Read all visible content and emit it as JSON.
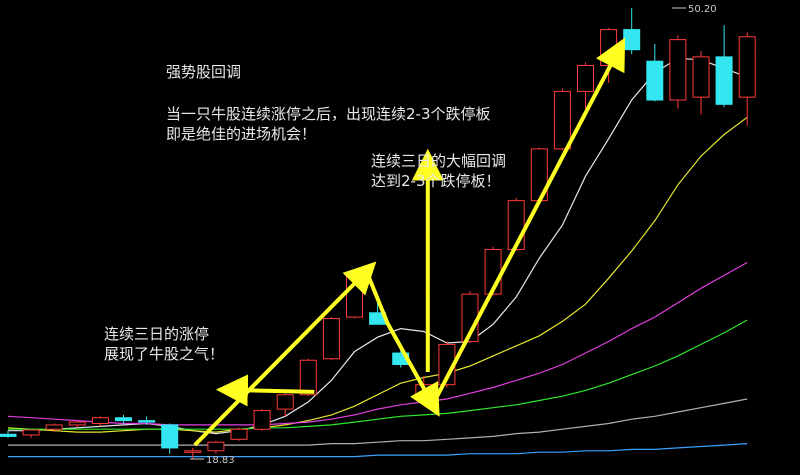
{
  "annotations": {
    "title": "强势股回调",
    "main_line1": "当一只牛股连续涨停之后，出现连续2-3个跌停板",
    "main_line2": "即是绝佳的进场机会！",
    "pullback_line1": "连续三日的大幅回调",
    "pullback_line2": "达到2-3个跌停板！",
    "limitup_line1": "连续三日的涨停",
    "limitup_line2": "展现了牛股之气！"
  },
  "chart_data": {
    "type": "candlestick",
    "price_high_label": "50.20",
    "price_low_label": "18.83",
    "colors": {
      "up": "#ff3b3b",
      "down": "#33e6f0",
      "ma5": "#e8e8e8",
      "ma10": "#e6e62e",
      "ma20": "#e040e0",
      "ma30": "#2ee62e",
      "ma60": "#b0b0b0",
      "ma120": "#3aa0ff",
      "arrow": "#ffff22"
    },
    "candles": [
      {
        "o": 20.55,
        "h": 20.8,
        "l": 20.3,
        "c": 20.4
      },
      {
        "o": 20.5,
        "h": 20.9,
        "l": 20.3,
        "c": 20.85
      },
      {
        "o": 20.9,
        "h": 21.3,
        "l": 20.7,
        "c": 21.2
      },
      {
        "o": 21.2,
        "h": 21.5,
        "l": 21.0,
        "c": 21.4
      },
      {
        "o": 21.3,
        "h": 21.8,
        "l": 21.1,
        "c": 21.7
      },
      {
        "o": 21.7,
        "h": 21.9,
        "l": 21.3,
        "c": 21.5
      },
      {
        "o": 21.5,
        "h": 21.8,
        "l": 21.2,
        "c": 21.4
      },
      {
        "o": 21.2,
        "h": 21.3,
        "l": 19.2,
        "c": 19.6
      },
      {
        "o": 19.3,
        "h": 19.6,
        "l": 18.83,
        "c": 19.4
      },
      {
        "o": 19.4,
        "h": 20.1,
        "l": 19.2,
        "c": 20.0
      },
      {
        "o": 20.2,
        "h": 21.0,
        "l": 20.1,
        "c": 20.9
      },
      {
        "o": 20.9,
        "h": 22.3,
        "l": 20.8,
        "c": 22.2
      },
      {
        "o": 22.3,
        "h": 23.4,
        "l": 21.8,
        "c": 23.3
      },
      {
        "o": 23.3,
        "h": 25.8,
        "l": 23.2,
        "c": 25.7
      },
      {
        "o": 25.8,
        "h": 28.7,
        "l": 25.7,
        "c": 28.6
      },
      {
        "o": 28.7,
        "h": 31.6,
        "l": 28.6,
        "c": 31.5
      },
      {
        "o": 29.0,
        "h": 30.2,
        "l": 28.5,
        "c": 28.2
      },
      {
        "o": 26.2,
        "h": 26.7,
        "l": 25.2,
        "c": 25.4
      },
      {
        "o": 23.3,
        "h": 24.6,
        "l": 22.9,
        "c": 24.0
      },
      {
        "o": 24.0,
        "h": 27.0,
        "l": 23.8,
        "c": 26.8
      },
      {
        "o": 27.0,
        "h": 30.5,
        "l": 26.9,
        "c": 30.3
      },
      {
        "o": 30.3,
        "h": 33.6,
        "l": 30.2,
        "c": 33.4
      },
      {
        "o": 33.4,
        "h": 37.0,
        "l": 33.3,
        "c": 36.8
      },
      {
        "o": 36.8,
        "h": 40.5,
        "l": 36.7,
        "c": 40.4
      },
      {
        "o": 40.4,
        "h": 44.6,
        "l": 40.3,
        "c": 44.4
      },
      {
        "o": 44.4,
        "h": 46.4,
        "l": 43.0,
        "c": 46.2
      },
      {
        "o": 46.2,
        "h": 48.8,
        "l": 45.0,
        "c": 48.7
      },
      {
        "o": 48.7,
        "h": 50.2,
        "l": 47.0,
        "c": 47.3
      },
      {
        "o": 46.5,
        "h": 47.7,
        "l": 43.7,
        "c": 43.8
      },
      {
        "o": 43.8,
        "h": 48.3,
        "l": 43.2,
        "c": 48.0
      },
      {
        "o": 44.0,
        "h": 47.2,
        "l": 42.8,
        "c": 46.8
      },
      {
        "o": 46.8,
        "h": 49.0,
        "l": 43.3,
        "c": 43.5
      },
      {
        "o": 44.0,
        "h": 48.5,
        "l": 42.0,
        "c": 48.2
      }
    ],
    "moving_averages": [
      {
        "key": "ma5",
        "values": [
          20.8,
          20.8,
          20.9,
          21.0,
          21.1,
          21.2,
          21.3,
          21.1,
          20.8,
          20.6,
          20.8,
          21.2,
          21.8,
          22.8,
          24.3,
          26.3,
          27.3,
          27.9,
          27.7,
          26.9,
          27.0,
          28.2,
          30.1,
          32.8,
          35.1,
          38.5,
          41.1,
          43.8,
          45.7,
          46.7,
          46.6,
          46.0,
          45.4
        ]
      },
      {
        "key": "ma10",
        "values": [
          21.0,
          20.9,
          20.8,
          20.7,
          20.7,
          20.8,
          20.9,
          20.9,
          20.8,
          20.7,
          20.9,
          21.0,
          21.2,
          21.5,
          21.9,
          22.5,
          23.3,
          24.1,
          24.5,
          24.8,
          25.3,
          26.0,
          26.7,
          27.4,
          28.4,
          29.6,
          31.4,
          33.3,
          35.4,
          37.9,
          39.9,
          41.4,
          42.6
        ]
      },
      {
        "key": "ma20",
        "values": [
          21.8,
          21.7,
          21.6,
          21.5,
          21.4,
          21.3,
          21.3,
          21.2,
          21.2,
          21.2,
          21.2,
          21.2,
          21.3,
          21.4,
          21.6,
          21.9,
          22.3,
          22.6,
          22.8,
          23.0,
          23.4,
          23.8,
          24.3,
          24.8,
          25.4,
          26.2,
          27.0,
          27.9,
          28.7,
          29.7,
          30.7,
          31.6,
          32.5
        ]
      },
      {
        "key": "ma30",
        "values": [
          20.9,
          20.9,
          20.9,
          20.9,
          20.9,
          20.9,
          20.9,
          20.9,
          20.9,
          20.9,
          20.9,
          21.0,
          21.0,
          21.1,
          21.2,
          21.4,
          21.6,
          21.8,
          21.9,
          22.0,
          22.2,
          22.4,
          22.6,
          22.9,
          23.2,
          23.6,
          24.1,
          24.7,
          25.3,
          26.0,
          26.8,
          27.6,
          28.5
        ]
      },
      {
        "key": "ma60",
        "values": [
          19.8,
          19.8,
          19.8,
          19.8,
          19.8,
          19.8,
          19.8,
          19.8,
          19.8,
          19.8,
          19.8,
          19.8,
          19.8,
          19.8,
          19.9,
          19.9,
          20.0,
          20.1,
          20.1,
          20.2,
          20.3,
          20.4,
          20.6,
          20.7,
          20.9,
          21.1,
          21.3,
          21.6,
          21.8,
          22.1,
          22.4,
          22.7,
          23.0
        ]
      },
      {
        "key": "ma120",
        "values": [
          19.0,
          19.0,
          19.0,
          19.0,
          19.0,
          19.0,
          19.0,
          19.0,
          19.0,
          19.0,
          19.0,
          19.0,
          19.0,
          19.0,
          19.0,
          19.0,
          19.1,
          19.1,
          19.1,
          19.1,
          19.2,
          19.2,
          19.2,
          19.3,
          19.3,
          19.4,
          19.4,
          19.5,
          19.5,
          19.6,
          19.7,
          19.8,
          19.9
        ]
      }
    ]
  }
}
